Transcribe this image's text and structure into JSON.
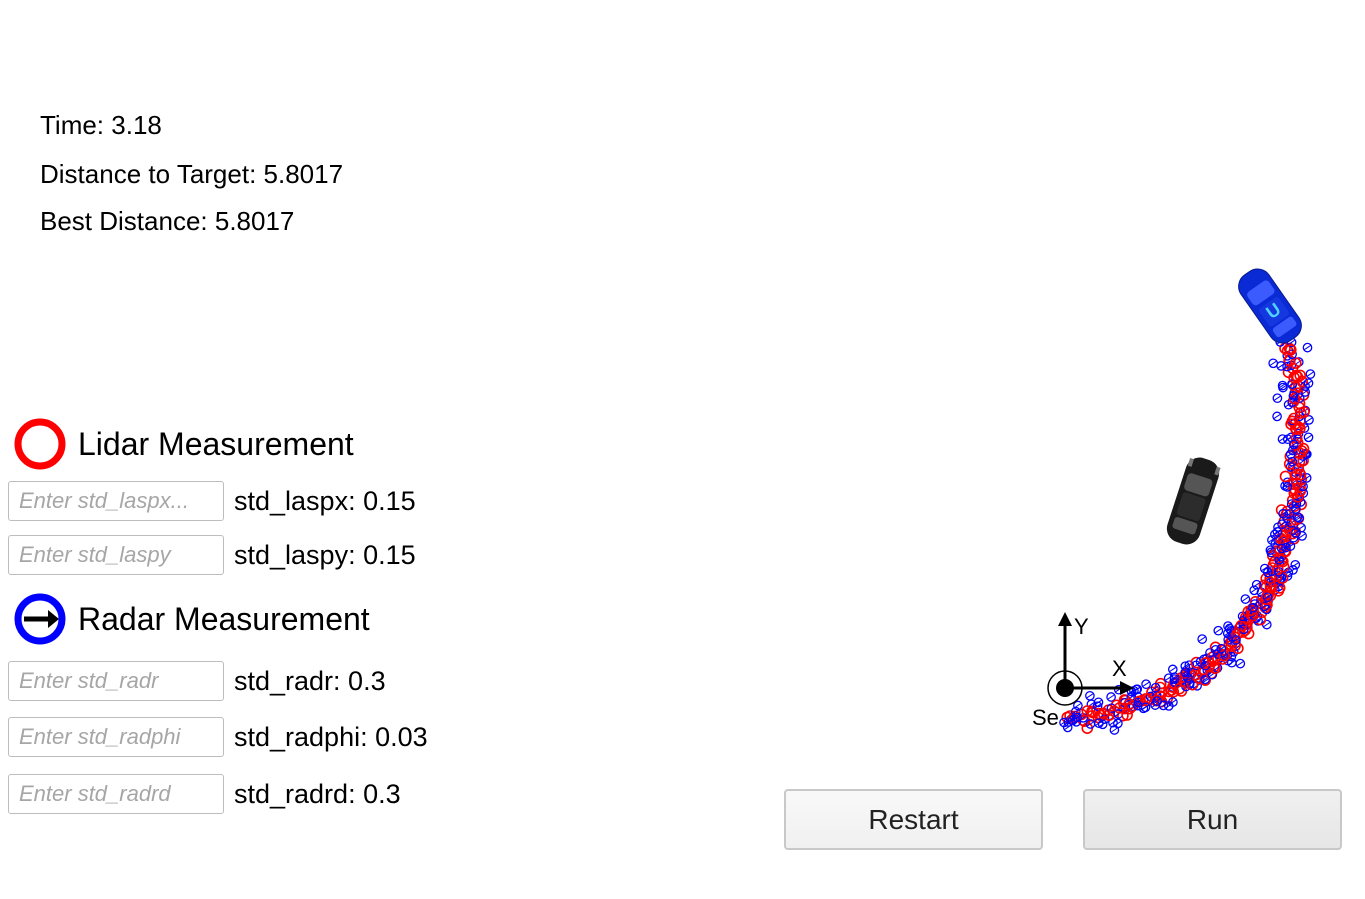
{
  "stats": {
    "time": "Time: 3.18",
    "distance": "Distance to Target: 5.8017",
    "best": "Best Distance: 5.8017"
  },
  "legend": {
    "lidar": "Lidar Measurement",
    "radar": "Radar Measurement",
    "lidar_color": "#ff0000",
    "radar_color": "#0000ff"
  },
  "params": [
    {
      "placeholder": "Enter std_laspx...",
      "label": "std_laspx: 0.15"
    },
    {
      "placeholder": "Enter std_laspy",
      "label": "std_laspy: 0.15"
    },
    {
      "placeholder": "Enter std_radr",
      "label": "std_radr: 0.3"
    },
    {
      "placeholder": "Enter std_radphi",
      "label": "std_radphi: 0.03"
    },
    {
      "placeholder": "Enter std_radrd",
      "label": "std_radrd: 0.3"
    }
  ],
  "buttons": {
    "restart": "Restart",
    "run": "Run"
  },
  "scene": {
    "axis_y_label": "Y",
    "axis_x_label": "X",
    "sensor_label": "Se"
  }
}
